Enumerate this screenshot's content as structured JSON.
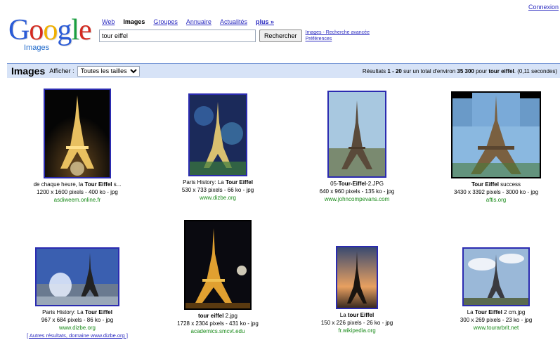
{
  "header": {
    "top_right_link": "Connexion",
    "logo_word": "Google",
    "logo_sub": "Images"
  },
  "nav": {
    "web": "Web",
    "images": "Images",
    "groups": "Groupes",
    "directory": "Annuaire",
    "news": "Actualités",
    "more": "plus »"
  },
  "search": {
    "query": "tour eiffel",
    "button_label": "Rechercher",
    "advanced_link": "Images - Recherche avancée",
    "prefs_link": "Préférences"
  },
  "results_bar": {
    "title": "Images",
    "show_label": "Afficher :",
    "selected_option": "Toutes les tailles",
    "summary_prefix": "Résultats",
    "range": "1 - 20",
    "summary_mid": "sur un total d'environ",
    "total": "35 300",
    "summary_for": "pour",
    "query_bold": "tour eiffel",
    "summary_time": ". (0,11 secondes)"
  },
  "images": [
    {
      "cap_pre": "de chaque heure, la ",
      "cap_bold": "Tour Eiffel",
      "cap_post": " s...",
      "meta": "1200 x 1600 pixels - 400 ko - jpg",
      "site": "asdiweem.online.fr"
    },
    {
      "cap_pre": "Paris History: La ",
      "cap_bold": "Tour Eiffel",
      "cap_post": "",
      "meta": "530 x 733 pixels - 66 ko - jpg",
      "site": "www.dizbe.org"
    },
    {
      "cap_pre": "05-",
      "cap_bold": "Tour-Eiffel",
      "cap_post": "-2.JPG",
      "meta": "640 x 960 pixels - 135 ko - jpg",
      "site": "www.johncompevans.com"
    },
    {
      "cap_pre": "",
      "cap_bold": "Tour Eiffel",
      "cap_post": " success",
      "meta": "3430 x 3392 pixels - 3000 ko - jpg",
      "site": "aftis.org"
    },
    {
      "cap_pre": "Paris History: La ",
      "cap_bold": "Tour Eiffel",
      "cap_post": "",
      "meta": "967 x 684 pixels - 86 ko - jpg",
      "site": "www.dizbe.org",
      "extra": "[ Autres résultats, domaine www.dizbe.org ]"
    },
    {
      "cap_pre": "",
      "cap_bold": "tour eiffel",
      "cap_post": " 2.jpg",
      "meta": "1728 x 2304 pixels - 431 ko - jpg",
      "site": "academics.smcvt.edu"
    },
    {
      "cap_pre": "La ",
      "cap_bold": "tour Eiffel",
      "cap_post": "",
      "meta": "150 x 226 pixels - 26 ko - jpg",
      "site": "fr.wikipedia.org"
    },
    {
      "cap_pre": "La ",
      "cap_bold": "Tour Eiffel",
      "cap_post": " 2 cm.jpg",
      "meta": "300 x 269 pixels - 23 ko - jpg",
      "site": "www.tourarbrit.net"
    }
  ],
  "colors": {
    "link": "#2a2ac0",
    "site_green": "#198a19",
    "bar_bg": "#d7e3f7",
    "thumb_border": "#2b2bb0"
  }
}
